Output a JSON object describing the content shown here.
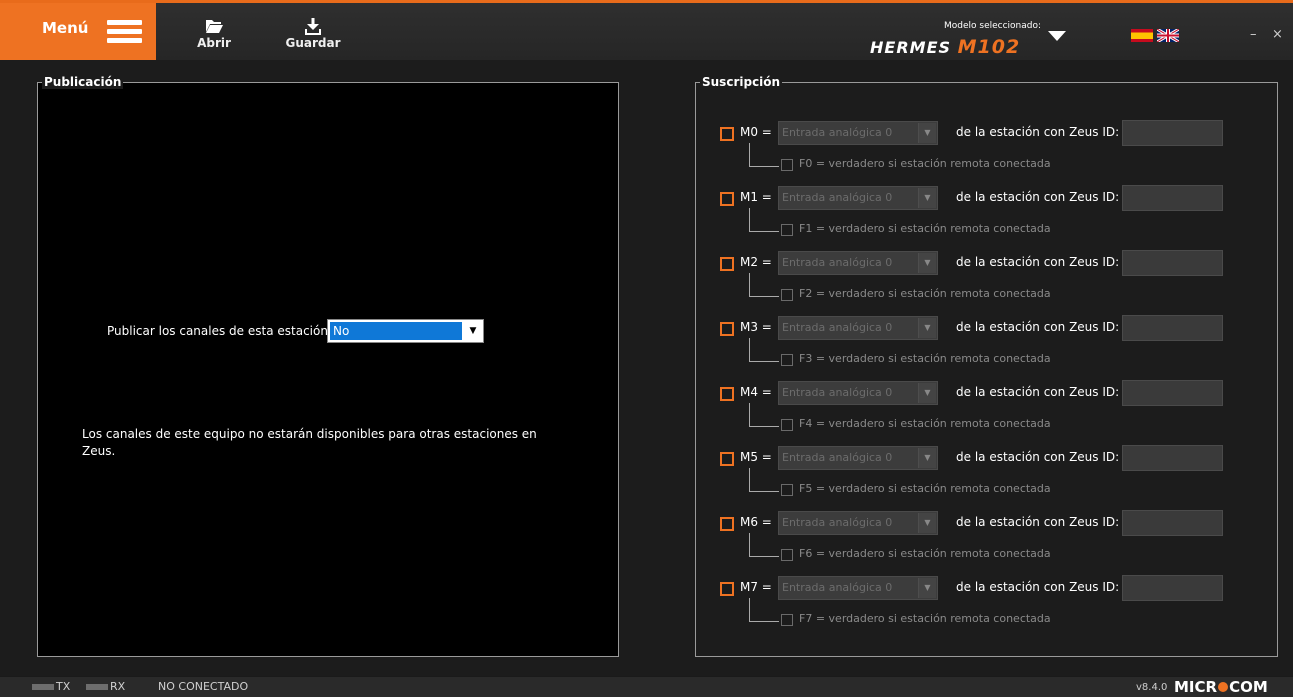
{
  "toolbar": {
    "menu_label": "Menú",
    "open_label": "Abrir",
    "save_label": "Guardar",
    "model_selected_label": "Modelo seleccionado:",
    "model_name": "HERMES ",
    "model_code": "M102",
    "minimize": "–",
    "close": "×"
  },
  "publication": {
    "title": "Publicación",
    "publish_label": "Publicar los canales de esta estación:",
    "publish_value": "No",
    "note": "Los canales de este equipo no estarán disponibles para otras estaciones en Zeus."
  },
  "subscription": {
    "title": "Suscripción",
    "rows": [
      {
        "m": "M0 =",
        "entry": "Entrada analógica 0",
        "zeus": "de la estación con Zeus ID:",
        "f": "F0 = verdadero si estación remota conectada"
      },
      {
        "m": "M1 =",
        "entry": "Entrada analógica 0",
        "zeus": "de la estación con Zeus ID:",
        "f": "F1 = verdadero si estación remota conectada"
      },
      {
        "m": "M2 =",
        "entry": "Entrada analógica 0",
        "zeus": "de la estación con Zeus ID:",
        "f": "F2 = verdadero si estación remota conectada"
      },
      {
        "m": "M3 =",
        "entry": "Entrada analógica 0",
        "zeus": "de la estación con Zeus ID:",
        "f": "F3 = verdadero si estación remota conectada"
      },
      {
        "m": "M4 =",
        "entry": "Entrada analógica 0",
        "zeus": "de la estación con Zeus ID:",
        "f": "F4 = verdadero si estación remota conectada"
      },
      {
        "m": "M5 =",
        "entry": "Entrada analógica 0",
        "zeus": "de la estación con Zeus ID:",
        "f": "F5 = verdadero si estación remota conectada"
      },
      {
        "m": "M6 =",
        "entry": "Entrada analógica 0",
        "zeus": "de la estación con Zeus ID:",
        "f": "F6 = verdadero si estación remota conectada"
      },
      {
        "m": "M7 =",
        "entry": "Entrada analógica 0",
        "zeus": "de la estación con Zeus ID:",
        "f": "F7 = verdadero si estación remota conectada"
      }
    ]
  },
  "status": {
    "tx": "TX",
    "rx": "RX",
    "connection": "NO CONECTADO",
    "version": "v8.4.0",
    "brand_left": "MICR",
    "brand_right": "COM"
  },
  "colors": {
    "accent": "#ee7222",
    "selection": "#0f78d7"
  }
}
